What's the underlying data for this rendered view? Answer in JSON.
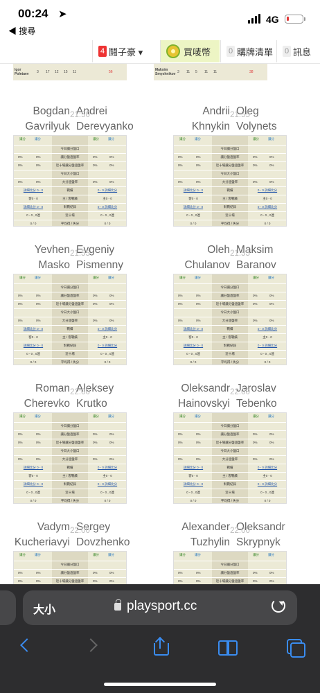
{
  "status_bar": {
    "time": "00:24",
    "back_label": "◀ 搜尋",
    "network": "4G",
    "battery_level": 0.15,
    "location_arrow_icon": "location-arrow-icon"
  },
  "nav": {
    "items": [
      {
        "badge": "4",
        "label": "鬪子豪 ▾",
        "badge_color": "#e33"
      },
      {
        "label": "買唛幣",
        "icon": "coin-icon"
      },
      {
        "badge": "0",
        "label": "購牌清單"
      },
      {
        "badge": "0",
        "label": "訊息"
      }
    ]
  },
  "stubs": {
    "left": {
      "name": "Igor Poletaev",
      "values": [
        "3",
        "17",
        "12",
        "15",
        "11",
        "",
        "",
        "",
        "56"
      ]
    },
    "right": {
      "name": "Maksim Smyshnikov",
      "values": [
        "3",
        "11",
        "5",
        "11",
        "11",
        "",
        "",
        "",
        "38"
      ]
    }
  },
  "table": {
    "head_left": [
      "讓分",
      "讓分"
    ],
    "head_right": [
      "讓分",
      "讓分"
    ],
    "rows": [
      {
        "m": "今日讓分盤口"
      },
      {
        "l1": "0%",
        "l2": "0%",
        "m": "讓分盤過盤率",
        "r1": "0%",
        "r2": "0%"
      },
      {
        "l1": "0%",
        "l2": "0%",
        "m": "近十場讓分盤過盤率",
        "r1": "0%",
        "r2": "0%"
      },
      {
        "m": "今日大小盤口"
      },
      {
        "l1": "0%",
        "l2": "0%",
        "m": "大分過盤率",
        "r1": "0%",
        "r2": "0%"
      },
      {
        "l": "詳細比分 0 - 0",
        "m": "戰績",
        "r": "0 - 0 詳細比分",
        "link": true
      },
      {
        "l": "客0 - 0",
        "m": "主 / 客戰績",
        "r": "主0 - 0"
      },
      {
        "l": "詳細比分 0 - 0",
        "m": "對戰紀錄",
        "r": "0 - 0 詳細比分",
        "link": true
      },
      {
        "l": "0 - 0 , 0連",
        "m": "近十場",
        "r": "0 - 0 , 0連"
      },
      {
        "l": "0 / 0",
        "m": "平均得 / 失分",
        "r": "0 / 0"
      }
    ]
  },
  "matches": [
    {
      "p1_first": "Bogdan",
      "p1_last": "Gavrilyuk",
      "time": "21:50",
      "p2_first": "Andrei",
      "p2_last": "Derevyanko"
    },
    {
      "p1_first": "Andrii",
      "p1_last": "Khnykin",
      "time": "21:55",
      "p2_first": "Oleg",
      "p2_last": "Volynets"
    },
    {
      "p1_first": "Yevhen",
      "p1_last": "Masko",
      "time": "21:55",
      "p2_first": "Evgeniy",
      "p2_last": "Pismenny"
    },
    {
      "p1_first": "Oleh",
      "p1_last": "Chulanov",
      "time": "21:55",
      "p2_first": "Maksim",
      "p2_last": "Baranov"
    },
    {
      "p1_first": "Roman",
      "p1_last": "Cherevko",
      "time": "22:00",
      "p2_first": "Aleksey",
      "p2_last": "Krutko"
    },
    {
      "p1_first": "Oleksandr",
      "p1_last": "Hainovskyi",
      "time": "22:00",
      "p2_first": "Jaroslav",
      "p2_last": "Tebenko"
    },
    {
      "p1_first": "Vadym",
      "p1_last": "Kucheriavyi",
      "time": "22:00",
      "p2_first": "Sergey",
      "p2_last": "Dovzhenko"
    },
    {
      "p1_first": "Alexander",
      "p1_last": "Tuzhylin",
      "time": "22:00",
      "p2_first": "Oleksandr",
      "p2_last": "Skrypnyk"
    }
  ],
  "browser": {
    "text_size_label": "大小",
    "url": "playsport.cc"
  },
  "colors": {
    "accent": "#3a8cf0",
    "table_bg": "#ecead6",
    "coin_bg": "#edf5c4"
  }
}
